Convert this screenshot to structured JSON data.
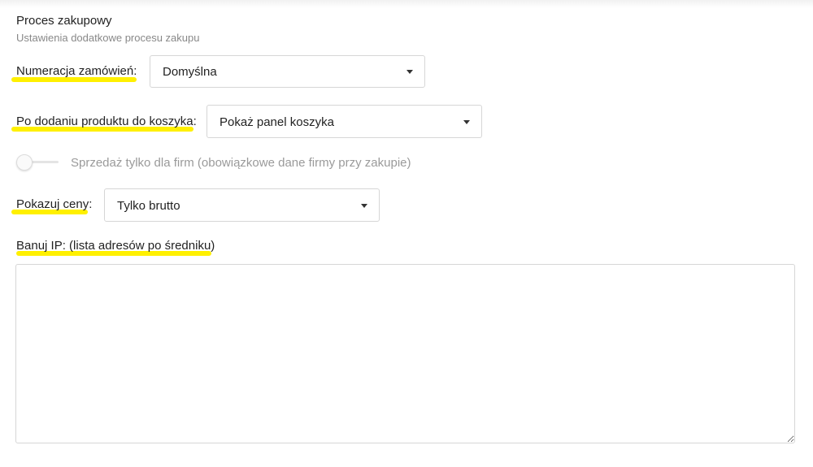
{
  "section": {
    "title": "Proces zakupowy",
    "subtitle": "Ustawienia dodatkowe procesu zakupu"
  },
  "order_numbering": {
    "label": "Numeracja zamówień:",
    "selected": "Domyślna"
  },
  "after_add_to_cart": {
    "label": "Po dodaniu produktu do koszyka:",
    "selected": "Pokaż panel koszyka"
  },
  "b2b_only": {
    "label": "Sprzedaż tylko dla firm (obowiązkowe dane firmy przy zakupie)",
    "enabled": false
  },
  "show_prices": {
    "label": "Pokazuj ceny:",
    "selected": "Tylko brutto"
  },
  "ban_ip": {
    "label": "Banuj IP: (lista adresów po średniku)",
    "value": ""
  },
  "colors": {
    "highlight": "#fff000",
    "border": "#d6d6d6",
    "muted_text": "#9a9a9a"
  }
}
